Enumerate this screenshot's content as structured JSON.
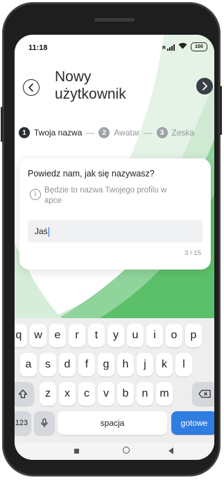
{
  "status_bar": {
    "time": "11:18",
    "signal_label": "R",
    "battery_label": "100"
  },
  "header": {
    "title": "Nowy użytkownik",
    "back_icon": "chevron-left-icon",
    "next_icon": "chevron-right-icon"
  },
  "stepper": {
    "steps": [
      {
        "number": "1",
        "label": "Twoja nazwa",
        "state": "active"
      },
      {
        "number": "2",
        "label": "Awatar",
        "state": "inactive"
      },
      {
        "number": "3",
        "label": "Zeska",
        "state": "inactive"
      }
    ],
    "separator": "—"
  },
  "card": {
    "question": "Powiedz nam, jak się nazywasz?",
    "hint": "Będzie to nazwa Twojego profilu w apce",
    "info_icon": "info-icon",
    "input_value": "Jaś",
    "counter": "3 / 15"
  },
  "keyboard": {
    "row1": [
      "q",
      "w",
      "e",
      "r",
      "t",
      "y",
      "u",
      "i",
      "o",
      "p"
    ],
    "row2": [
      "a",
      "s",
      "d",
      "f",
      "g",
      "h",
      "j",
      "k",
      "l"
    ],
    "row3": [
      "z",
      "x",
      "c",
      "v",
      "b",
      "n",
      "m"
    ],
    "shift_icon": "shift-icon",
    "backspace_icon": "backspace-icon",
    "numbers_label": "123",
    "mic_icon": "mic-icon",
    "space_label": "spacja",
    "done_label": "gotowe"
  },
  "colors": {
    "accent_green": "#5cc06a",
    "done_blue": "#2f7de1",
    "dark_button": "#3a3f46"
  }
}
